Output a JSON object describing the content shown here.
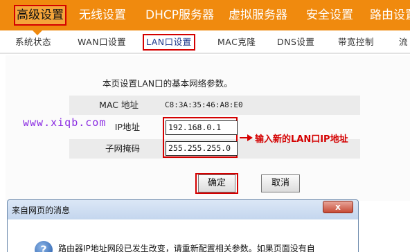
{
  "topnav": {
    "items": [
      "高级设置",
      "无线设置",
      "DHCP服务器",
      "虚拟服务器",
      "安全设置",
      "路由设置"
    ]
  },
  "subnav": {
    "items": [
      "系统状态",
      "WAN口设置",
      "LAN口设置",
      "MAC克隆",
      "DNS设置",
      "带宽控制",
      "流"
    ]
  },
  "page": {
    "description": "本页设置LAN口的基本网络参数。",
    "mac_label": "MAC 地址",
    "mac_value": "C8:3A:35:46:A8:E0",
    "ip_label": "IP地址",
    "ip_value": "192.168.0.1",
    "mask_label": "子网掩码",
    "mask_value": "255.255.255.0",
    "annotation": "输入新的LAN口IP地址",
    "watermark": "www.xiqb.com",
    "ok_label": "确定",
    "cancel_label": "取消"
  },
  "dialog": {
    "title": "来自网页的消息",
    "close": "x",
    "icon": "?",
    "message": "路由器IP地址网段已发生改变，请重新配置相关参数。如果页面没有自"
  },
  "colors": {
    "nav_orange": "#f08a0e",
    "highlight_red": "#d40000",
    "watermark_purple": "#8a2be2"
  }
}
